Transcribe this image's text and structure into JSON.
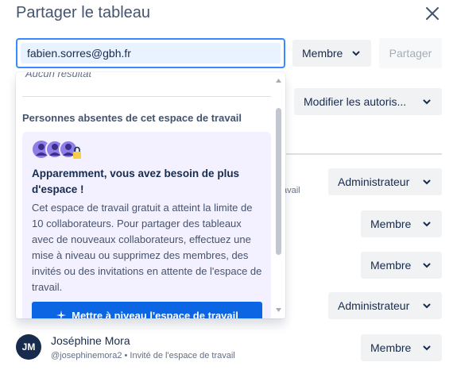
{
  "dialog": {
    "title": "Partager le tableau"
  },
  "invite": {
    "email_value": "fabien.sorres@gbh.fr",
    "role_label": "Membre",
    "share_label": "Partager"
  },
  "permissions": {
    "label": "Modifier les autoris..."
  },
  "dropdown": {
    "no_result": "Aucun résultat",
    "section_heading": "Personnes absentes de cet espace de travail",
    "upsell": {
      "title": "Apparemment, vous avez besoin de plus d'espace !",
      "body": "Cet espace de travail gratuit a atteint la limite de 10 collaborateurs. Pour partager des tableaux avec de nouveaux collaborateurs, effectuez une mise à niveau ou supprimez des membres, des invités ou des invitations en attente de l'espace de travail.",
      "button_label": "Mettre à niveau l'espace de travail"
    }
  },
  "members": [
    {
      "role": "Administrateur",
      "sub_fragment": "avail"
    },
    {
      "role": "Membre"
    },
    {
      "role": "Membre"
    },
    {
      "role": "Administrateur"
    },
    {
      "initials": "JM",
      "name": "Joséphine Mora",
      "sub": "@josephinemora2 • Invité de l'espace de travail",
      "role": "Membre"
    }
  ],
  "colors": {
    "accent": "#0c66e4",
    "focus_border": "#388bff",
    "upsell_bg": "#f3f0ff",
    "avatar_purple": "#8f7ee7"
  }
}
